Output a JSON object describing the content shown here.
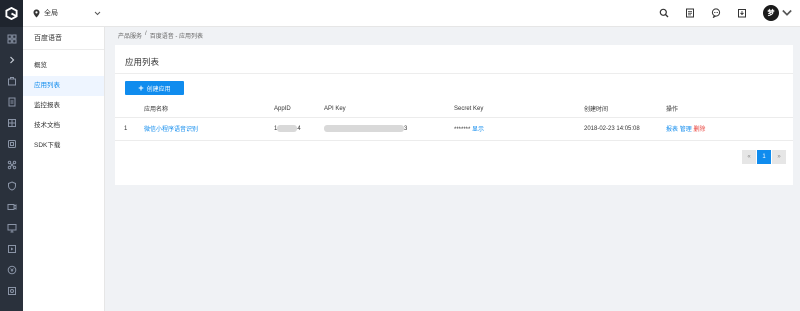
{
  "topbar": {
    "region_label": "全局",
    "avatar_text": "梦"
  },
  "subnav": {
    "title": "百度语音",
    "items": [
      {
        "label": "概览"
      },
      {
        "label": "应用列表"
      },
      {
        "label": "监控报表"
      },
      {
        "label": "技术文档"
      },
      {
        "label": "SDK下载"
      }
    ]
  },
  "breadcrumb": {
    "part1": "产品服务",
    "sep": "/",
    "part2": "百度语音 - 应用列表"
  },
  "card": {
    "title": "应用列表",
    "create_label": "创建应用"
  },
  "table": {
    "headers": {
      "name": "应用名称",
      "appid": "AppID",
      "apikey": "API Key",
      "secret": "Secret Key",
      "created": "创建时间",
      "ops": "操作"
    },
    "rows": [
      {
        "index": "1",
        "name": "微信小程序语音识别",
        "appid_prefix": "1",
        "appid_suffix": "4",
        "apikey_suffix": "3",
        "secret_masked": "*******",
        "secret_show": "显示",
        "created": "2018-02-23 14:05:08",
        "op_report": "报表",
        "op_manage": "管理",
        "op_delete": "删除"
      }
    ]
  },
  "pager": {
    "prev": "«",
    "current": "1",
    "next": "»"
  },
  "colors": {
    "accent": "#108cee",
    "danger": "#e8403a",
    "rail": "#2a313c"
  }
}
